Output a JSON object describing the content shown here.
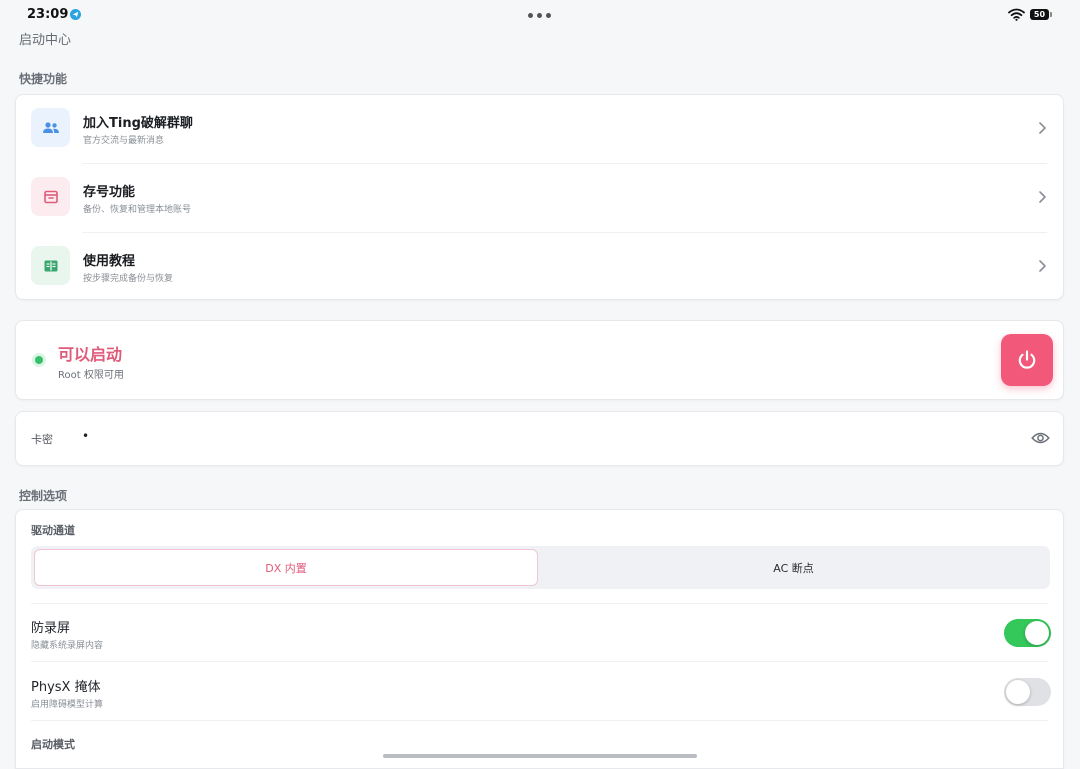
{
  "status_bar": {
    "time": "23:09",
    "battery": "50"
  },
  "page": {
    "title": "启动中心"
  },
  "quick": {
    "section_label": "快捷功能",
    "items": [
      {
        "title": "加入Ting破解群聊",
        "subtitle": "官方交流与最新消息",
        "icon": "users-icon",
        "icon_color": "#4a90e2",
        "icon_bg": "#eaf3fd"
      },
      {
        "title": "存号功能",
        "subtitle": "备份、恢复和管理本地账号",
        "icon": "archive-icon",
        "icon_color": "#e05a7a",
        "icon_bg": "#fdecef"
      },
      {
        "title": "使用教程",
        "subtitle": "按步骤完成备份与恢复",
        "icon": "book-icon",
        "icon_color": "#3aa66e",
        "icon_bg": "#e8f6ee"
      }
    ]
  },
  "status": {
    "title": "可以启动",
    "subtitle": "Root 权限可用",
    "accent": "#f2587a"
  },
  "key": {
    "label": "卡密",
    "value": "•"
  },
  "control": {
    "section_label": "控制选项",
    "driver_label": "驱动通道",
    "channels": [
      "DX 内置",
      "AC 断点"
    ],
    "selected_channel": "DX 内置",
    "options": [
      {
        "title": "防录屏",
        "subtitle": "隐藏系统录屏内容",
        "enabled": true
      },
      {
        "title": "PhysX 掩体",
        "subtitle": "启用障碍模型计算",
        "enabled": false
      }
    ],
    "launch_mode_label": "启动模式"
  }
}
